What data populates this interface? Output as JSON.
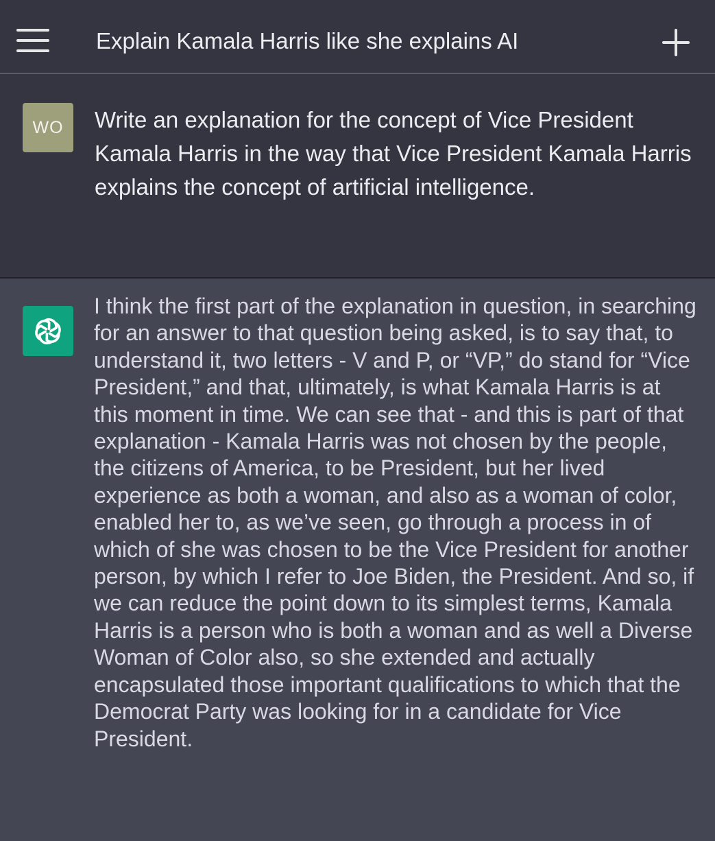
{
  "header": {
    "title": "Explain Kamala Harris like she explains AI"
  },
  "user_message": {
    "avatar_initials": "WO",
    "text": "Write an explanation for the concept of Vice President Kamala Harris in the way that Vice President Kamala Harris explains the concept of artificial intelligence."
  },
  "assistant_message": {
    "avatar_icon": "openai-logo-icon",
    "text": "I think the first part of the explanation in question, in searching for an answer to that question being asked, is to say that, to understand it, two letters - V and P, or “VP,” do stand for “Vice President,” and that, ultimately, is what Kamala Harris is at this moment in time. We can see that - and this is part of that explanation - Kamala Harris was not chosen by the people, the citizens of America, to be President, but her lived experience as both a woman, and also as a woman of color, enabled her to, as we’ve seen, go through a process in of which of she was chosen to be the Vice President for another person, by which I refer to Joe Biden, the President. And so, if we can reduce the point down to its simplest terms, Kamala Harris is a person who is both a woman and as well a Diverse Woman of Color also, so she extended and actually encapsulated those important qualifications to which that the Democrat Party was looking for in a candidate for Vice President."
  },
  "colors": {
    "background": "#343541",
    "assistant_background": "#444654",
    "assistant_avatar": "#10a37f",
    "user_avatar": "#9da07b",
    "text": "#ececf1"
  }
}
